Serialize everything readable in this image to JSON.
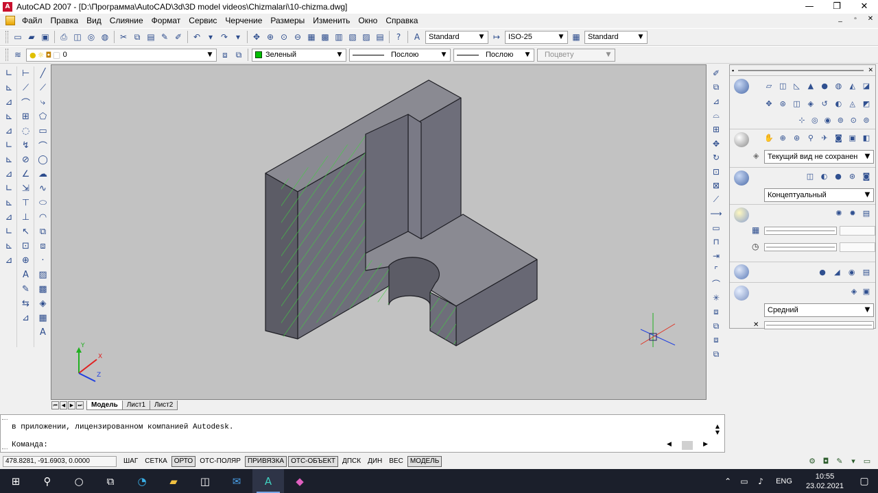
{
  "window": {
    "title": "AutoCAD 2007 - [D:\\Программа\\AutoCAD\\3d\\3D model videos\\Chizmalari\\10-chizma.dwg]",
    "controls": [
      "—",
      "❐",
      "✕"
    ],
    "doc_controls": [
      "_",
      "▫",
      "✕"
    ]
  },
  "menu": [
    "Файл",
    "Правка",
    "Вид",
    "Слияние",
    "Формат",
    "Сервис",
    "Черчение",
    "Размеры",
    "Изменить",
    "Окно",
    "Справка"
  ],
  "toolbar_standard": {
    "text_style": "Standard",
    "dim_style": "ISO-25",
    "table_style": "Standard"
  },
  "toolbar_layers": {
    "layer": "0",
    "color": "Зеленый",
    "linetype": "Послою",
    "lineweight": "Послою",
    "plotstyle": "Поцвету",
    "accent_green": "#00c000"
  },
  "tabs": [
    "Модель",
    "Лист1",
    "Лист2"
  ],
  "dashboard": {
    "view_combo": "Текущий вид не сохранен",
    "visual_style": "Концептуальный",
    "quality": "Средний"
  },
  "command": {
    "history": "в приложении, лицензированном компанией Autodesk.",
    "prompt": "Команда:"
  },
  "status": {
    "coords": "478.8281, -91.6903, 0.0000",
    "buttons": [
      {
        "label": "ШАГ",
        "on": false
      },
      {
        "label": "СЕТКА",
        "on": false
      },
      {
        "label": "ОРТО",
        "on": true
      },
      {
        "label": "ОТС-ПОЛЯР",
        "on": false
      },
      {
        "label": "ПРИВЯЗКА",
        "on": true
      },
      {
        "label": "ОТС-ОБЪЕКТ",
        "on": true
      },
      {
        "label": "ДПСК",
        "on": false
      },
      {
        "label": "ДИН",
        "on": false
      },
      {
        "label": "ВЕС",
        "on": false
      },
      {
        "label": "МОДЕЛЬ",
        "on": true
      }
    ]
  },
  "ucs": {
    "x": "X",
    "y": "Y",
    "z": "Z"
  },
  "taskbar": {
    "lang": "ENG",
    "time": "10:55",
    "date": "23.02.2021"
  },
  "colors": {
    "model_face": "#6b6b78",
    "model_top": "#8a8a92",
    "model_dark": "#55555f",
    "hatch": "#3fcf3f",
    "background": "#c2c2c2"
  }
}
